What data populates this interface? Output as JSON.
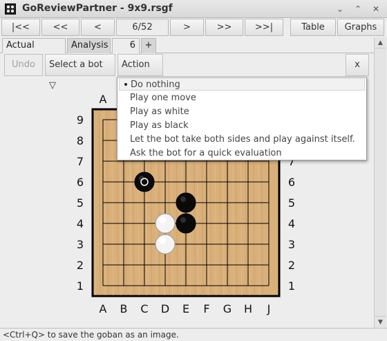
{
  "window": {
    "title": "GoReviewPartner - 9x9.rsgf",
    "controls": [
      "minimize",
      "maximize",
      "close"
    ]
  },
  "navigation": {
    "first": "|<<",
    "back10": "<<",
    "back": "<",
    "position": "6/52",
    "forward": ">",
    "forward10": ">>",
    "last": ">>|",
    "table": "Table",
    "graphs": "Graphs"
  },
  "tabs": {
    "actual_game": "Actual game",
    "analysis": "Analysis",
    "move_number": "6",
    "add": "+"
  },
  "toolbar": {
    "undo": "Undo",
    "select_bot": "Select a bot ▽",
    "action": "Action ▽",
    "close": "x"
  },
  "action_menu": {
    "items": [
      "Do nothing",
      "Play one move",
      "Play as white",
      "Play as black",
      "Let the bot take both sides and play against itself.",
      "Ask the bot for a quick evaluation"
    ],
    "selected_index": 0
  },
  "board": {
    "size": 9,
    "columns": [
      "A",
      "B",
      "C",
      "D",
      "E",
      "F",
      "G",
      "H",
      "J"
    ],
    "rows": [
      "9",
      "8",
      "7",
      "6",
      "5",
      "4",
      "3",
      "2",
      "1"
    ],
    "stones": [
      {
        "color": "black",
        "point": "C6",
        "last_move": true
      },
      {
        "color": "black",
        "point": "E5"
      },
      {
        "color": "black",
        "point": "E4"
      },
      {
        "color": "white",
        "point": "D4"
      },
      {
        "color": "white",
        "point": "D3"
      }
    ],
    "wood_color": "#d9b07a",
    "line_color": "#000000"
  },
  "status": {
    "text": "<Ctrl+Q> to save the goban as an image."
  }
}
